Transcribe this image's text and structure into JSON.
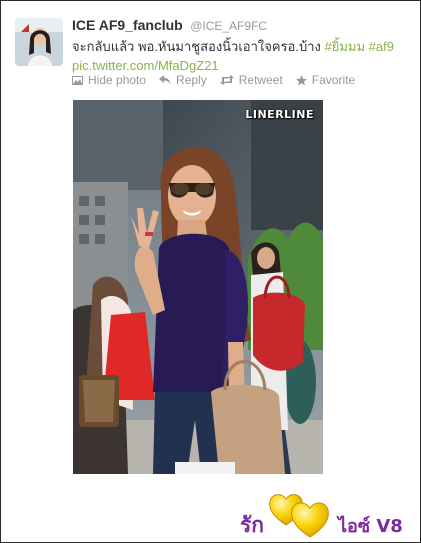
{
  "tweet": {
    "display_name": "ICE AF9_fanclub",
    "handle": "@ICE_AF9FC",
    "text_plain": "จะกลับแล้ว พอ.หันมาชูสองนิ้วเอาใจครอ.บ้าง ",
    "hashtags": [
      "#ยิ้มมม",
      "#af9"
    ],
    "link": "pic.twitter.com/MfaDgZ21"
  },
  "actions": {
    "hide_photo": "Hide photo",
    "reply": "Reply",
    "retweet": "Retweet",
    "favorite": "Favorite"
  },
  "photo": {
    "watermark": "LINERLINE"
  },
  "footer": {
    "left_text": "รัก",
    "right_text": "ไอซ์ V8"
  },
  "colors": {
    "accent": "#8ab34a",
    "footer_purple": "#7b2aa0",
    "hearts": "#f5c400"
  }
}
